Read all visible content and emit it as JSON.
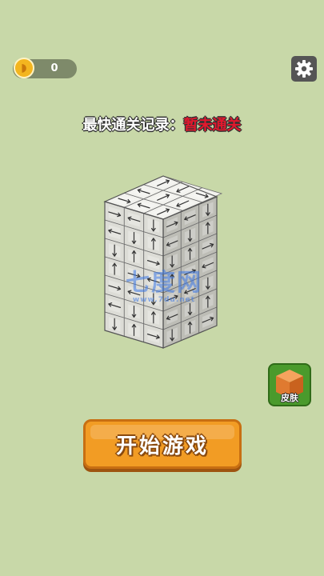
{
  "hud": {
    "coins": "0",
    "coin_icon": "coin-icon",
    "settings_icon": "gear-icon"
  },
  "record": {
    "label": "最快通关记录：",
    "value": "暂未通关"
  },
  "cube": {
    "columns": 3,
    "rows": 7,
    "depth": 3
  },
  "watermark": {
    "main": "七度网",
    "sub": "www.7du.net"
  },
  "skin_button": {
    "label": "皮肤"
  },
  "start_button": {
    "label": "开始游戏"
  },
  "colors": {
    "background": "#c8d8a8",
    "accent": "#f29c24",
    "record_value": "#e2182d"
  }
}
